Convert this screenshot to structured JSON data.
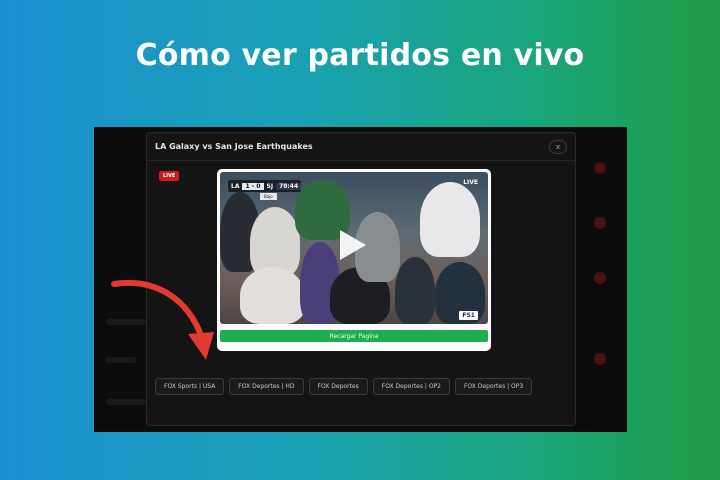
{
  "headline": "Cómo ver partidos en vivo",
  "modal": {
    "title": "LA Galaxy vs San Jose Earthquakes",
    "close_label": "x",
    "live_badge": "LIVE"
  },
  "video": {
    "scorebug": {
      "team1": "LA",
      "score": "1 - 0",
      "team2": "SJ",
      "time": "78:44",
      "sub": "Bajo"
    },
    "live_label": "LIVE",
    "channel_logo": "FS1"
  },
  "reload_label": "Recargar Pagina",
  "channels": [
    {
      "label": "FOX Sports | USA"
    },
    {
      "label": "FOX Deportes | HD"
    },
    {
      "label": "FOX Deportes"
    },
    {
      "label": "FOX Deportes | OP2"
    },
    {
      "label": "FOX Deportes | OP3"
    }
  ],
  "colors": {
    "live_red": "#c81e1e",
    "reload_green": "#1fae4f",
    "arrow_red": "#e23b2e"
  }
}
